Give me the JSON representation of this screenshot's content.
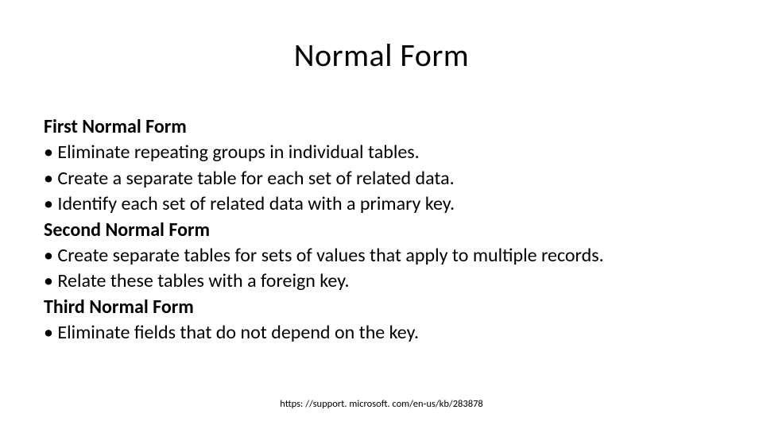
{
  "title": "Normal Form",
  "sections": [
    {
      "heading": "First Normal Form",
      "bullets": [
        "Eliminate repeating groups in individual tables.",
        "Create a separate table for each set of related data.",
        "Identify each set of related data with a primary key."
      ]
    },
    {
      "heading": "Second Normal Form",
      "bullets": [
        "Create separate tables for sets of values that apply to multiple records.",
        "Relate these tables with a foreign key."
      ]
    },
    {
      "heading": "Third Normal Form",
      "bullets": [
        "Eliminate fields that do not depend on the key."
      ]
    }
  ],
  "footerLink": "https: //support. microsoft. com/en-us/kb/283878",
  "bulletChar": "• "
}
